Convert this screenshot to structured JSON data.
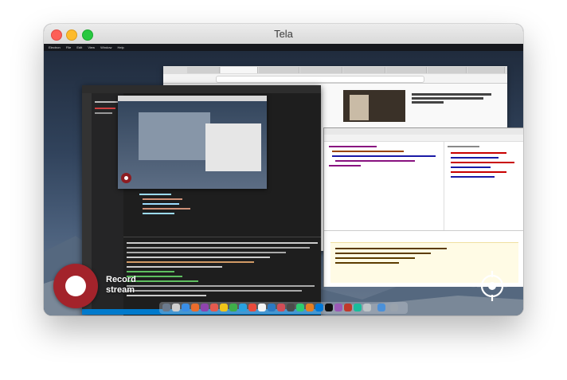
{
  "window": {
    "title": "Tela"
  },
  "screen": {
    "menubar": [
      "Electron",
      "File",
      "Edit",
      "View",
      "Window",
      "Help"
    ],
    "nested_recorder": {
      "icon": "record-icon"
    }
  },
  "controls": {
    "record_label_line1": "Record",
    "record_label_line2": "stream",
    "record_icon": "record-icon",
    "target_icon": "crosshair-icon"
  },
  "colors": {
    "record_red": "#a3232b",
    "close": "#fd5f57",
    "minimize": "#fdbb2d",
    "zoom": "#27c840"
  }
}
